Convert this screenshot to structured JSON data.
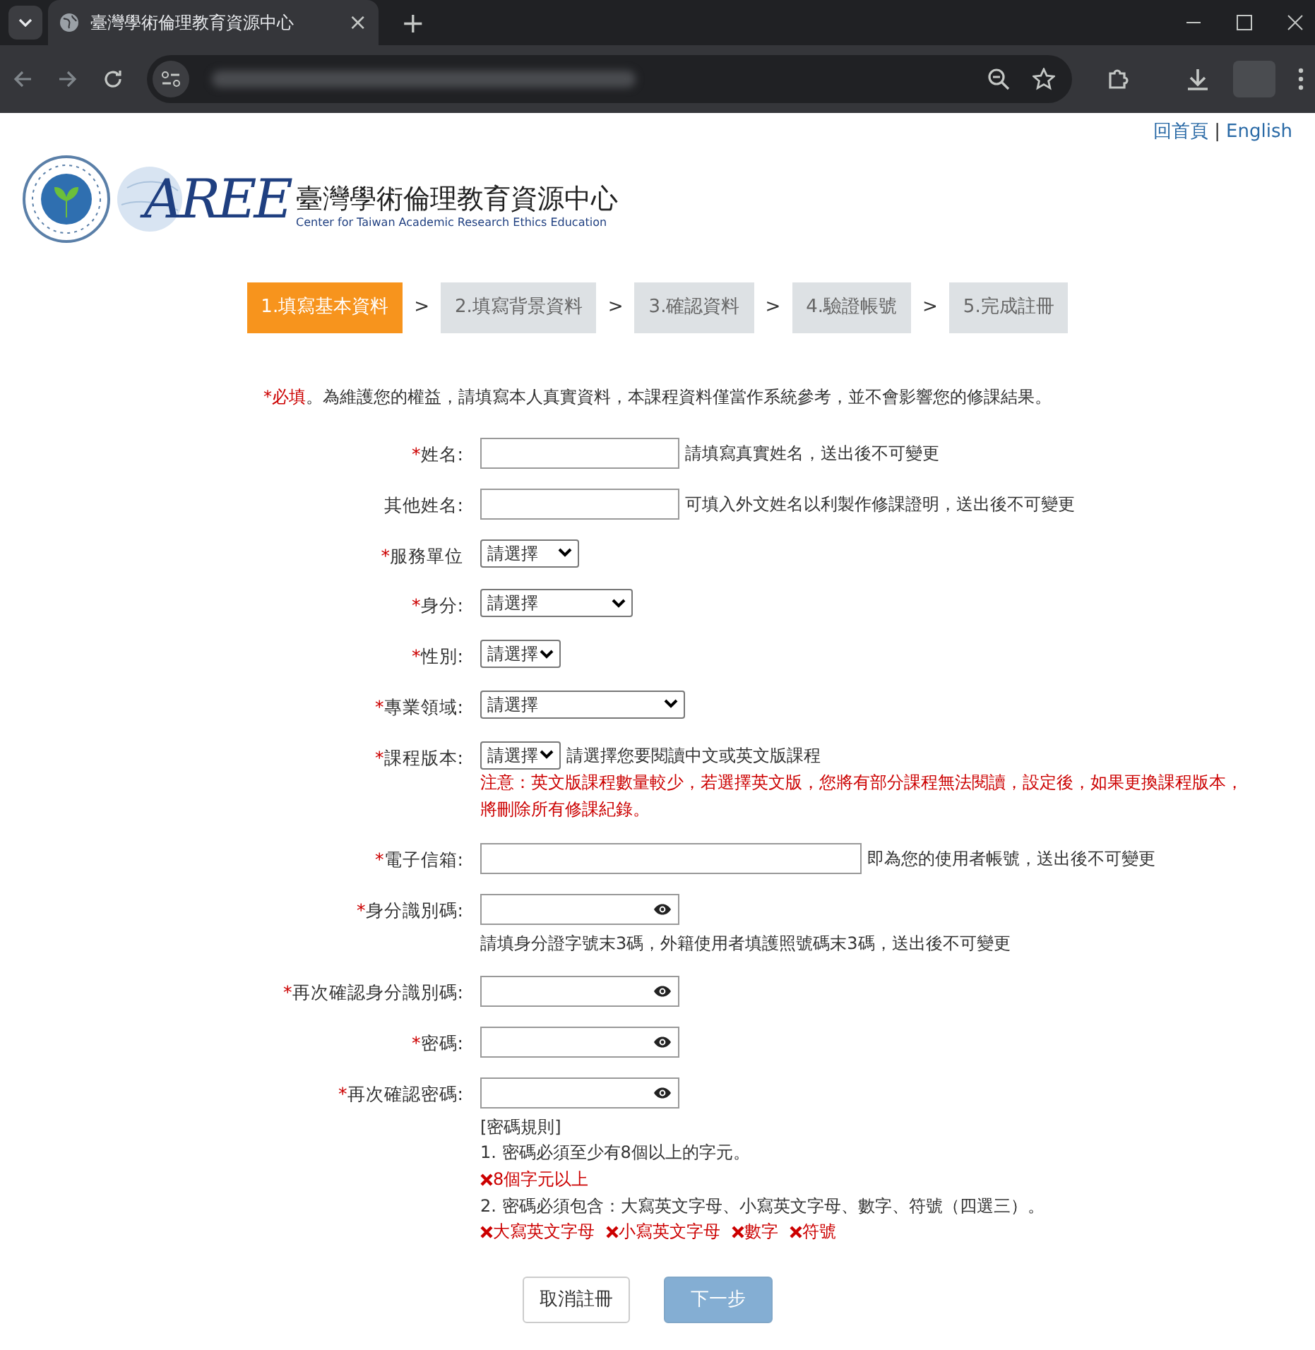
{
  "browser": {
    "tab_title": "臺灣學術倫理教育資源中心",
    "close_glyph": "×",
    "new_tab_glyph": "+"
  },
  "top_links": [
    {
      "label": "回首頁"
    },
    {
      "label": "English"
    }
  ],
  "top_links_separator": "|",
  "logo": {
    "mark": "AREE",
    "title": "臺灣學術倫理教育資源中心",
    "subtitle": "Center for Taiwan Academic Research Ethics Education"
  },
  "steps": [
    {
      "label": "1.填寫基本資料",
      "selected": true
    },
    {
      "label": "2.填寫背景資料",
      "selected": false
    },
    {
      "label": "3.確認資料",
      "selected": false
    },
    {
      "label": "4.驗證帳號",
      "selected": false
    },
    {
      "label": "5.完成註冊",
      "selected": false
    }
  ],
  "step_separator": ">",
  "notice": {
    "required": "*必填",
    "text": "。為維護您的權益，請填寫本人真實資料，本課程資料僅當作系統參考，並不會影響您的修課結果。"
  },
  "fields": [
    {
      "kind": "text",
      "mark": "*",
      "label": "姓名:",
      "hint": "請填寫真實姓名，送出後不可變更"
    },
    {
      "kind": "text",
      "label": "其他姓名:",
      "hint": "可填入外文姓名以利製作修課證明，送出後不可變更"
    },
    {
      "kind": "select",
      "mark": "*",
      "label": "服務單位",
      "value": "請選擇"
    },
    {
      "kind": "select",
      "mark": "*",
      "label": "身分:",
      "value": "請選擇"
    },
    {
      "kind": "select",
      "mark": "*",
      "label": "性別:",
      "value": "請選擇"
    },
    {
      "kind": "select",
      "mark": "*",
      "label": "專業領域:",
      "value": "請選擇"
    },
    {
      "kind": "select",
      "mark": "*",
      "label": "課程版本:",
      "value": "請選擇",
      "hint": "請選擇您要閱讀中文或英文版課程",
      "warning": "注意：英文版課程數量較少，若選擇英文版，您將有部分課程無法閱讀，設定後，如果更換課程版本，將刪除所有修課紀錄。"
    },
    {
      "kind": "text",
      "mark": "*",
      "label": "電子信箱:",
      "hint": "即為您的使用者帳號，送出後不可變更"
    },
    {
      "kind": "password",
      "mark": "*",
      "label": "身分識別碼:",
      "note": "請填身分證字號末3碼，外籍使用者填護照號碼末3碼，送出後不可變更"
    },
    {
      "kind": "password",
      "mark": "*",
      "label": "再次確認身分識別碼:"
    },
    {
      "kind": "password",
      "mark": "*",
      "label": "密碼:"
    },
    {
      "kind": "password",
      "mark": "*",
      "label": "再次確認密碼:"
    }
  ],
  "password_rules": {
    "title": "[密碼規則]",
    "lines": [
      {
        "kind": "rule",
        "text": "1. 密碼必須至少有8個以上的字元。"
      },
      {
        "kind": "checks",
        "items": [
          {
            "text": "8個字元以上",
            "met": false
          }
        ]
      },
      {
        "kind": "rule",
        "text": "2. 密碼必須包含：大寫英文字母、小寫英文字母、數字、符號（四選三）。"
      },
      {
        "kind": "checks",
        "items": [
          {
            "text": "大寫英文字母",
            "met": false
          },
          {
            "text": "小寫英文字母",
            "met": false
          },
          {
            "text": "數字",
            "met": false
          },
          {
            "text": "符號",
            "met": false
          }
        ]
      }
    ]
  },
  "buttons": [
    {
      "kind": "cancel",
      "label": "取消註冊",
      "disabled": false
    },
    {
      "kind": "primary",
      "label": "下一步",
      "disabled": true
    }
  ]
}
